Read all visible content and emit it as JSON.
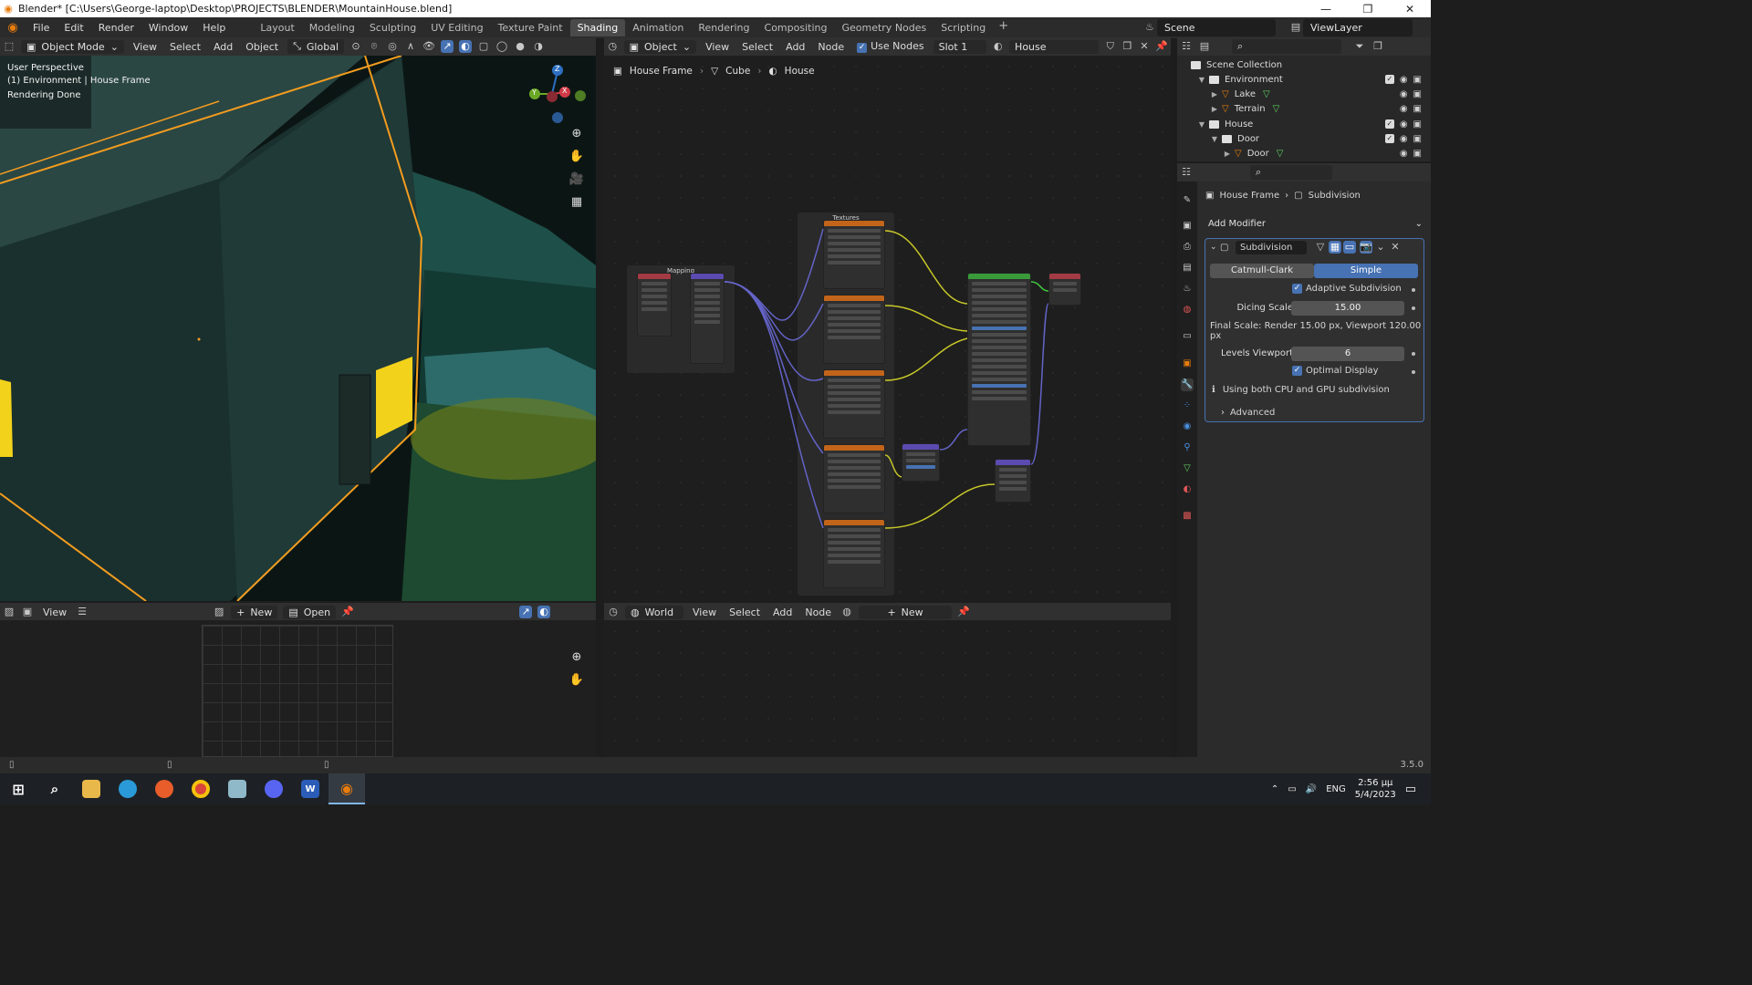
{
  "window": {
    "title": "Blender* [C:\\Users\\George-laptop\\Desktop\\PROJECTS\\BLENDER\\MountainHouse.blend]",
    "minimize": "—",
    "maximize": "❐",
    "close": "✕"
  },
  "menus": [
    "File",
    "Edit",
    "Render",
    "Window",
    "Help"
  ],
  "workspaces": [
    {
      "label": "Layout"
    },
    {
      "label": "Modeling"
    },
    {
      "label": "Sculpting"
    },
    {
      "label": "UV Editing"
    },
    {
      "label": "Texture Paint"
    },
    {
      "label": "Shading"
    },
    {
      "label": "Animation"
    },
    {
      "label": "Rendering"
    },
    {
      "label": "Compositing"
    },
    {
      "label": "Geometry Nodes"
    },
    {
      "label": "Scripting"
    }
  ],
  "active_workspace": "Shading",
  "scene": "Scene",
  "view_layer": "ViewLayer",
  "viewport_header": {
    "mode": "Object Mode",
    "menu": [
      "View",
      "Select",
      "Add",
      "Object"
    ],
    "orientation": "Global"
  },
  "viewport": {
    "line1": "User Perspective",
    "line2": "(1) Environment | House Frame",
    "line3": "Rendering Done",
    "gizmo": {
      "z": "Z",
      "y": "Y",
      "x": "X"
    }
  },
  "node_header": {
    "type": "Object",
    "menu": [
      "View",
      "Select",
      "Add",
      "Node"
    ],
    "use_nodes": "Use Nodes",
    "slot": "Slot 1",
    "material": "House"
  },
  "node_breadcrumb": {
    "object": "House Frame",
    "mesh": "Cube",
    "material": "House"
  },
  "node_frames": {
    "mapping": "Mapping",
    "textures": "Textures"
  },
  "image_editor_header": {
    "view": "View",
    "new": "New",
    "open": "Open"
  },
  "world_header": {
    "type": "World",
    "menu": [
      "View",
      "Select",
      "Add",
      "Node"
    ],
    "new": "New"
  },
  "outliner": {
    "rows": [
      {
        "label": "Scene Collection",
        "kind": "scene",
        "indent": 0
      },
      {
        "label": "Environment",
        "kind": "collection",
        "indent": 1
      },
      {
        "label": "Lake",
        "kind": "object",
        "indent": 2
      },
      {
        "label": "Terrain",
        "kind": "object",
        "indent": 2
      },
      {
        "label": "House",
        "kind": "collection",
        "indent": 1
      },
      {
        "label": "Door",
        "kind": "collection",
        "indent": 2
      },
      {
        "label": "Door",
        "kind": "object",
        "indent": 3
      }
    ]
  },
  "properties": {
    "breadcrumb_object": "House Frame",
    "breadcrumb_modifier": "Subdivision",
    "add_modifier": "Add Modifier",
    "modifier_name": "Subdivision",
    "catmull": "Catmull-Clark",
    "simple": "Simple",
    "adaptive": "Adaptive Subdivision",
    "dicing_label": "Dicing Scale",
    "dicing_value": "15.00",
    "final_scale": "Final Scale: Render 15.00 px, Viewport 120.00 px",
    "levels_label": "Levels Viewport",
    "levels_value": "6",
    "optimal": "Optimal Display",
    "info": "Using both CPU and GPU subdivision",
    "advanced": "Advanced"
  },
  "status": {
    "version": "3.5.0"
  },
  "taskbar": {
    "lang": "ENG",
    "time": "2:56 μμ",
    "date": "5/4/2023"
  },
  "colors": {
    "accent": "#4772b3",
    "orange": "#e87d0d",
    "selection": "#f39c1f"
  }
}
